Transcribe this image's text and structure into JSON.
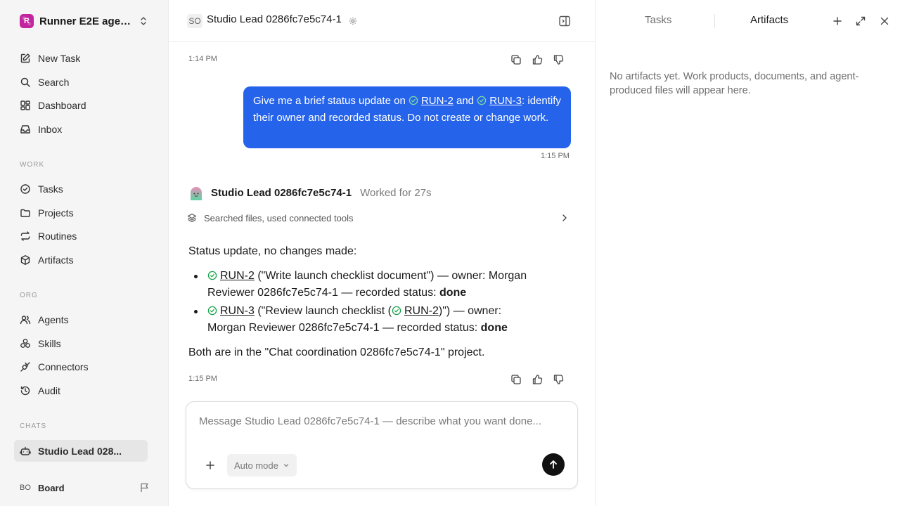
{
  "sidebar": {
    "workspace_name": "Runner E2E agen...",
    "workspace_initial": "R",
    "nav_top": [
      {
        "label": "New Task",
        "icon": "edit-icon"
      },
      {
        "label": "Search",
        "icon": "search-icon"
      },
      {
        "label": "Dashboard",
        "icon": "dashboard-icon"
      },
      {
        "label": "Inbox",
        "icon": "inbox-icon"
      }
    ],
    "section_work": "WORK",
    "nav_work": [
      {
        "label": "Tasks",
        "icon": "check-circle-icon"
      },
      {
        "label": "Projects",
        "icon": "folder-icon"
      },
      {
        "label": "Routines",
        "icon": "repeat-icon"
      },
      {
        "label": "Artifacts",
        "icon": "box-icon"
      }
    ],
    "section_org": "ORG",
    "nav_org": [
      {
        "label": "Agents",
        "icon": "users-icon"
      },
      {
        "label": "Skills",
        "icon": "skills-icon"
      },
      {
        "label": "Connectors",
        "icon": "plug-icon"
      },
      {
        "label": "Audit",
        "icon": "history-icon"
      }
    ],
    "section_chats": "CHATS",
    "chats": [
      {
        "label": "Studio Lead 028...",
        "icon": "bot-icon",
        "active": true
      }
    ],
    "user": {
      "initials": "BO",
      "name": "Board"
    }
  },
  "chat": {
    "agent_initials": "SO",
    "title": "Studio Lead 0286fc7e5c74-1",
    "first_time": "1:14 PM",
    "user_message": {
      "prefix": "Give me a brief status update on ",
      "ref1": "RUN-2",
      "middle": " and ",
      "ref2": "RUN-3",
      "suffix": ": identify their owner and recorded status. Do not create or change work.",
      "time": "1:15 PM"
    },
    "assistant": {
      "name": "Studio Lead 0286fc7e5c74-1",
      "worked": "Worked for 27s",
      "tools_summary": "Searched files, used connected tools",
      "intro": "Status update, no changes made:",
      "items": [
        {
          "ref": "RUN-2",
          "text_a": " (\"Write launch checklist document\") — owner: Morgan Reviewer 0286fc7e5c74-1 — recorded status: ",
          "status": "done"
        },
        {
          "ref": "RUN-3",
          "text_a": " (\"Review launch checklist (",
          "inner_ref": "RUN-2",
          "text_b": ")\") — owner: Morgan Reviewer 0286fc7e5c74-1 — recorded status: ",
          "status": "done"
        }
      ],
      "closing": "Both are in the \"Chat coordination 0286fc7e5c74-1\" project.",
      "time": "1:15 PM"
    },
    "composer": {
      "placeholder": "Message Studio Lead 0286fc7e5c74-1 — describe what you want done...",
      "mode_label": "Auto mode"
    }
  },
  "right_panel": {
    "tab_tasks": "Tasks",
    "tab_artifacts": "Artifacts",
    "empty_text": "No artifacts yet. Work products, documents, and agent-produced files will appear here."
  },
  "colors": {
    "accent_blue": "#2563eb",
    "success_green": "#16a34a",
    "logo_magenta": "#c2259e"
  }
}
